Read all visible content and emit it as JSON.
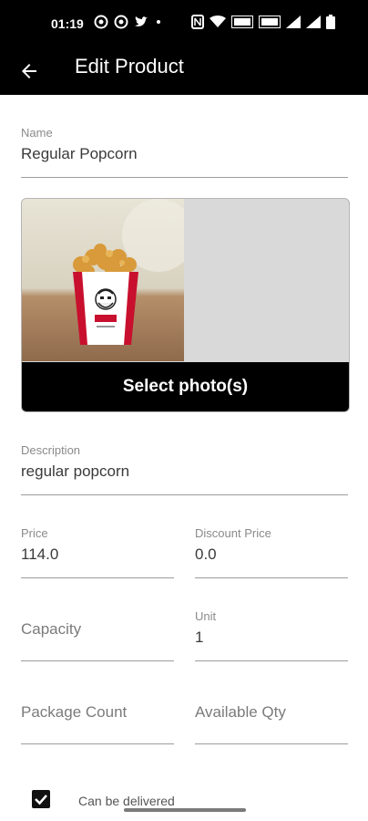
{
  "status_bar": {
    "time": "01:19",
    "left_icons": [
      "whatsapp-icon",
      "whatsapp-icon",
      "twitter-icon",
      "dot-icon"
    ],
    "right_icons": [
      "nfc-icon",
      "wifi-icon",
      "volte-icon",
      "volte-icon",
      "signal-icon",
      "signal-icon",
      "battery-icon"
    ]
  },
  "app_bar": {
    "title": "Edit Product",
    "back_icon": "arrow-left-icon"
  },
  "form": {
    "name": {
      "label": "Name",
      "value": "Regular Popcorn"
    },
    "photo": {
      "button_label": "Select photo(s)",
      "product_brand": "KFC"
    },
    "description": {
      "label": "Description",
      "value": "regular popcorn"
    },
    "price": {
      "label": "Price",
      "value": "114.0"
    },
    "discount_price": {
      "label": "Discount Price",
      "value": "0.0"
    },
    "capacity": {
      "placeholder": "Capacity"
    },
    "unit": {
      "label": "Unit",
      "value": "1"
    },
    "package_count": {
      "placeholder": "Package Count"
    },
    "available_qty": {
      "placeholder": "Available Qty"
    },
    "can_be_delivered": {
      "label": "Can be delivered",
      "checked": true
    }
  },
  "colors": {
    "bar_background": "#000000",
    "photo_area": "#d9d9d9",
    "kfc_red": "#c8102e"
  }
}
